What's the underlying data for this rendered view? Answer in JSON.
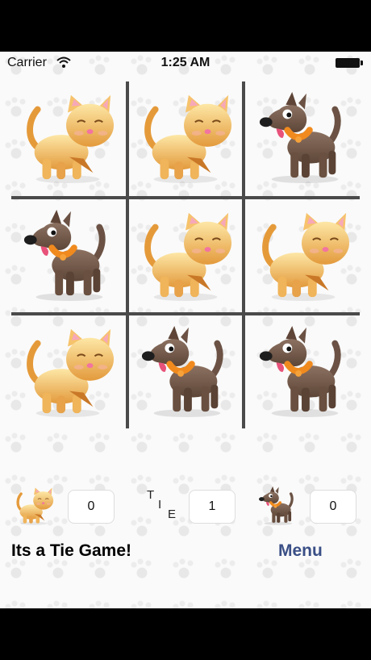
{
  "status_bar": {
    "carrier": "Carrier",
    "time": "1:25 AM"
  },
  "board": {
    "cells": [
      {
        "piece": "cat"
      },
      {
        "piece": "cat"
      },
      {
        "piece": "dog"
      },
      {
        "piece": "dog"
      },
      {
        "piece": "cat"
      },
      {
        "piece": "cat"
      },
      {
        "piece": "cat"
      },
      {
        "piece": "dog"
      },
      {
        "piece": "dog"
      }
    ]
  },
  "scores": {
    "cat_score": "0",
    "tie_letters": [
      "T",
      "I",
      "E"
    ],
    "tie_score": "1",
    "dog_score": "0"
  },
  "result_text": "Its a Tie Game!",
  "menu_label": "Menu",
  "colors": {
    "grid": "#4a4a4a",
    "menu": "#3a4f86"
  }
}
